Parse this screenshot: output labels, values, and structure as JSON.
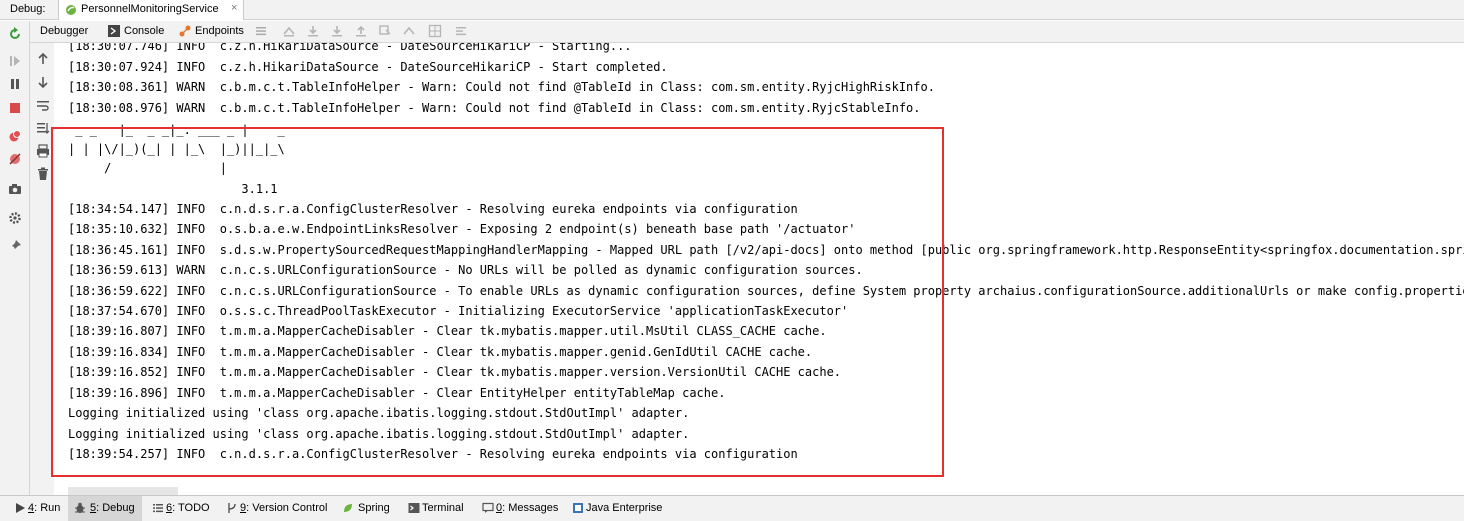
{
  "titlebar": {
    "label": "Debug:",
    "tab_name": "PersonnelMonitoringService",
    "tab_close": "×"
  },
  "toolbar": {
    "tabs": [
      {
        "label": "Debugger"
      },
      {
        "label": "Console"
      },
      {
        "label": "Endpoints"
      }
    ]
  },
  "console": {
    "lines": [
      "[18:30:07.746] INFO  c.z.h.HikariDataSource - DateSourceHikariCP - Starting...",
      "[18:30:07.924] INFO  c.z.h.HikariDataSource - DateSourceHikariCP - Start completed.",
      "[18:30:08.361] WARN  c.b.m.c.t.TableInfoHelper - Warn: Could not find @TableId in Class: com.sm.entity.RyjcHighRiskInfo.",
      "[18:30:08.976] WARN  c.b.m.c.t.TableInfoHelper - Warn: Could not find @TableId in Class: com.sm.entity.RyjcStableInfo.",
      " _ _   |_  _ _|_. ___ _ |    _ ",
      "| | |\\/|_)(_| | |_\\  |_)||_|_\\ ",
      "     /               |         ",
      "                        3.1.1 ",
      "[18:34:54.147] INFO  c.n.d.s.r.a.ConfigClusterResolver - Resolving eureka endpoints via configuration",
      "[18:35:10.632] INFO  o.s.b.a.e.w.EndpointLinksResolver - Exposing 2 endpoint(s) beneath base path '/actuator'",
      "[18:36:45.161] INFO  s.d.s.w.PropertySourcedRequestMappingHandlerMapping - Mapped URL path [/v2/api-docs] onto method [public org.springframework.http.ResponseEntity<springfox.documentation.spring.",
      "[18:36:59.613] WARN  c.n.c.s.URLConfigurationSource - No URLs will be polled as dynamic configuration sources.",
      "[18:36:59.622] INFO  c.n.c.s.URLConfigurationSource - To enable URLs as dynamic configuration sources, define System property archaius.configurationSource.additionalUrls or make config.properties a",
      "[18:37:54.670] INFO  o.s.s.c.ThreadPoolTaskExecutor - Initializing ExecutorService 'applicationTaskExecutor'",
      "[18:39:16.807] INFO  t.m.m.a.MapperCacheDisabler - Clear tk.mybatis.mapper.util.MsUtil CLASS_CACHE cache.",
      "[18:39:16.834] INFO  t.m.m.a.MapperCacheDisabler - Clear tk.mybatis.mapper.genid.GenIdUtil CACHE cache.",
      "[18:39:16.852] INFO  t.m.m.a.MapperCacheDisabler - Clear tk.mybatis.mapper.version.VersionUtil CACHE cache.",
      "[18:39:16.896] INFO  t.m.m.a.MapperCacheDisabler - Clear EntityHelper entityTableMap cache.",
      "Logging initialized using 'class org.apache.ibatis.logging.stdout.StdOutImpl' adapter.",
      "Logging initialized using 'class org.apache.ibatis.logging.stdout.StdOutImpl' adapter.",
      "[18:39:54.257] INFO  c.n.d.s.r.a.ConfigClusterResolver - Resolving eureka endpoints via configuration"
    ]
  },
  "bottombar": {
    "items": [
      {
        "key": "4",
        "label": ": Run"
      },
      {
        "key": "5",
        "label": ": Debug"
      },
      {
        "key": "6",
        "label": ": TODO"
      },
      {
        "key": "9",
        "label": ": Version Control"
      },
      {
        "key": "",
        "label": "Spring"
      },
      {
        "key": "",
        "label": "Terminal"
      },
      {
        "key": "0",
        "label": ": Messages"
      },
      {
        "key": "",
        "label": "Java Enterprise"
      }
    ]
  },
  "colors": {
    "highlight_box": "#e53030",
    "panel_bg": "#f2f2f2",
    "console_bg": "#ffffff"
  }
}
